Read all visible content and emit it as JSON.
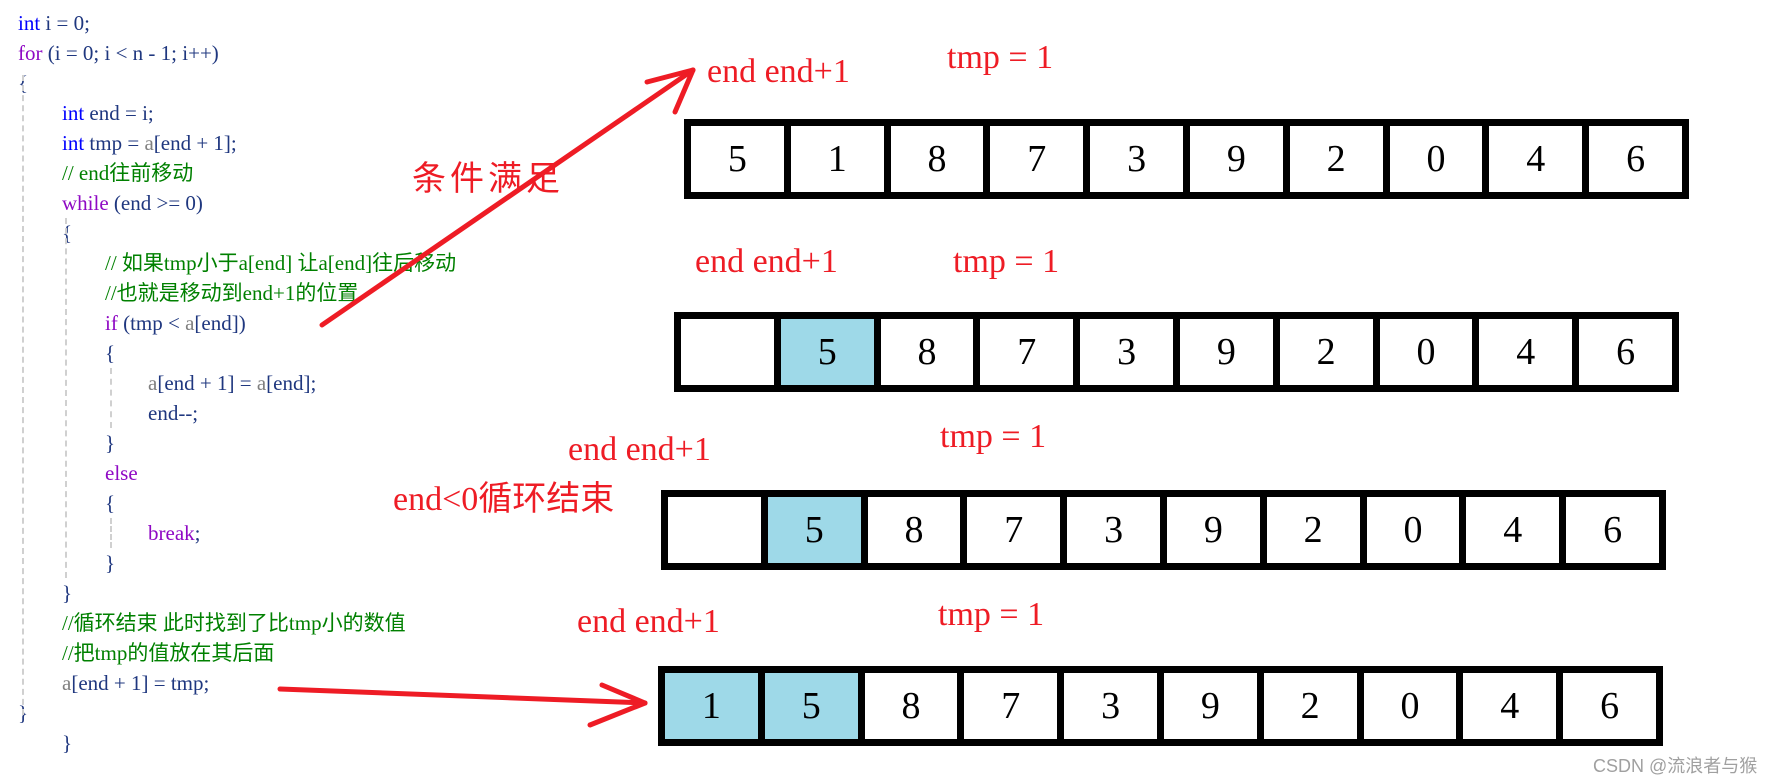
{
  "code": {
    "lines": [
      [
        {
          "t": "int",
          "c": "kw"
        },
        {
          "t": " i = 0;",
          "c": ""
        }
      ],
      [
        {
          "t": "for",
          "c": "ctl"
        },
        {
          "t": " (i = 0; i < n - 1; i++)",
          "c": ""
        }
      ],
      [
        {
          "t": "{",
          "c": ""
        }
      ],
      [
        {
          "t": "int",
          "c": "kw"
        },
        {
          "t": " end = i;",
          "c": ""
        }
      ],
      [
        {
          "t": "int",
          "c": "kw"
        },
        {
          "t": " tmp = ",
          "c": ""
        },
        {
          "t": "a",
          "c": "arr"
        },
        {
          "t": "[end + 1];",
          "c": ""
        }
      ],
      [
        {
          "t": "// end往前移动",
          "c": "cm"
        }
      ],
      [
        {
          "t": "while",
          "c": "ctl"
        },
        {
          "t": " (end >= 0)",
          "c": ""
        }
      ],
      [
        {
          "t": "{",
          "c": ""
        }
      ],
      [
        {
          "t": "// 如果tmp小于a[end] 让a[end]往后移动",
          "c": "cm"
        }
      ],
      [
        {
          "t": "//也就是移动到end+1的位置",
          "c": "cm"
        }
      ],
      [
        {
          "t": "if",
          "c": "ctl"
        },
        {
          "t": " (tmp < ",
          "c": ""
        },
        {
          "t": "a",
          "c": "arr"
        },
        {
          "t": "[end])",
          "c": ""
        }
      ],
      [
        {
          "t": "{",
          "c": ""
        }
      ],
      [
        {
          "t": "a",
          "c": "arr"
        },
        {
          "t": "[end + 1] = ",
          "c": ""
        },
        {
          "t": "a",
          "c": "arr"
        },
        {
          "t": "[end];",
          "c": ""
        }
      ],
      [
        {
          "t": "end--;",
          "c": ""
        }
      ],
      [
        {
          "t": "}",
          "c": ""
        }
      ],
      [
        {
          "t": "else",
          "c": "ctl"
        }
      ],
      [
        {
          "t": "{",
          "c": ""
        }
      ],
      [
        {
          "t": "break",
          "c": "ctl"
        },
        {
          "t": ";",
          "c": ""
        }
      ],
      [
        {
          "t": "}",
          "c": ""
        }
      ],
      [
        {
          "t": "}",
          "c": ""
        }
      ],
      [
        {
          "t": "//循环结束 此时找到了比tmp小的数值",
          "c": "cm"
        }
      ],
      [
        {
          "t": "//把tmp的值放在其后面",
          "c": "cm"
        }
      ],
      [
        {
          "t": "a",
          "c": "arr"
        },
        {
          "t": "[end + 1] = tmp;",
          "c": ""
        }
      ],
      [
        {
          "t": "}",
          "c": ""
        }
      ],
      [
        {
          "t": "}",
          "c": ""
        }
      ]
    ],
    "indents": [
      0,
      0,
      0,
      1,
      1,
      1,
      1,
      1,
      2,
      2,
      2,
      2,
      3,
      3,
      2,
      2,
      2,
      3,
      2,
      1,
      1,
      1,
      1,
      0,
      1
    ]
  },
  "annotations": {
    "condition_met": "条件满足",
    "loop_end": "end<0循环结束"
  },
  "steps": [
    {
      "end_label": "end end+1",
      "tmp_label": "tmp = 1",
      "cells": [
        "5",
        "1",
        "8",
        "7",
        "3",
        "9",
        "2",
        "0",
        "4",
        "6"
      ],
      "highlight": []
    },
    {
      "end_label": "end end+1",
      "tmp_label": "tmp = 1",
      "cells": [
        "",
        "5",
        "8",
        "7",
        "3",
        "9",
        "2",
        "0",
        "4",
        "6"
      ],
      "highlight": [
        1
      ]
    },
    {
      "end_label": "end end+1",
      "tmp_label": "tmp = 1",
      "cells": [
        "",
        "5",
        "8",
        "7",
        "3",
        "9",
        "2",
        "0",
        "4",
        "6"
      ],
      "highlight": [
        1
      ]
    },
    {
      "end_label": "end end+1",
      "tmp_label": "tmp = 1",
      "cells": [
        "1",
        "5",
        "8",
        "7",
        "3",
        "9",
        "2",
        "0",
        "4",
        "6"
      ],
      "highlight": [
        0,
        1
      ]
    }
  ],
  "colors": {
    "annotation": "#ee1c25",
    "highlight": "#9ed9e8",
    "keyword": "#0000ff",
    "control": "#8f08c4",
    "comment": "#008000"
  },
  "watermark": "CSDN @流浪者与猴"
}
